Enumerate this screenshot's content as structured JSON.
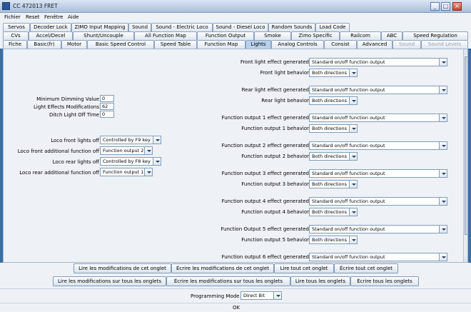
{
  "window": {
    "title": "CC 472013 FRET"
  },
  "menu": [
    "Fichier",
    "Reset",
    "Fenêtre",
    "Aide"
  ],
  "tabs": {
    "row1": [
      "Servos",
      "Decoder Lock",
      "ZIMO Input Mapping",
      "Sound",
      "Sound - Electric Loco",
      "Sound - Diesel Loco",
      "Random Sounds",
      "Load Code"
    ],
    "row2": [
      "CVs",
      "Accel/Decel",
      "Shunt/Uncouple",
      "All Function Map",
      "Function Output",
      "Smoke",
      "Zimo Specific",
      "Railcom",
      "ABC",
      "Speed Regulation"
    ],
    "row3": [
      "Fiche",
      "Basic(fr)",
      "Motor",
      "Basic Speed Control",
      "Speed Table",
      "Function Map",
      "Lights",
      "Analog Controls",
      "Consist",
      "Advanced",
      "Sound",
      "Sound Levels"
    ]
  },
  "left": {
    "dimming_label": "Minimum Dimming Value",
    "dimming_value": "0",
    "effects_label": "Light Effects Modifications",
    "effects_value": "62",
    "ditch_label": "Ditch Light Off Time",
    "ditch_value": "0",
    "loco_front_off_label": "Loco front lights off",
    "loco_front_off_value": "Controlled by F9 key",
    "loco_front_add_label": "Loco front additional function off",
    "loco_front_add_value": "Function output 2",
    "loco_rear_off_label": "Loco rear lights off",
    "loco_rear_off_value": "Controlled by F8 key",
    "loco_rear_add_label": "Loco rear additional function off",
    "loco_rear_add_value": "Function output 1"
  },
  "right": [
    {
      "effect_label": "Front light effect generated",
      "effect_value": "Standard on/off function output",
      "behavior_label": "Front light behavior",
      "behavior_value": "Both directions"
    },
    {
      "effect_label": "Rear light effect generated",
      "effect_value": "Standard on/off function output",
      "behavior_label": "Rear light behavior",
      "behavior_value": "Both directions"
    },
    {
      "effect_label": "Function output 1 effect generated",
      "effect_value": "Standard on/off function output",
      "behavior_label": "Function output 1 behavior",
      "behavior_value": "Both directions"
    },
    {
      "effect_label": "Function output 2 effect generated",
      "effect_value": "Standard on/off function output",
      "behavior_label": "Function output 2 behavior",
      "behavior_value": "Both directions"
    },
    {
      "effect_label": "Function output 3 effect generated",
      "effect_value": "Standard on/off function output",
      "behavior_label": "Function output 3 behavior",
      "behavior_value": "Both directions"
    },
    {
      "effect_label": "Function output 4 effect generated",
      "effect_value": "Standard on/off function output",
      "behavior_label": "Function output 4 behavior",
      "behavior_value": "Both directions"
    },
    {
      "effect_label": "Function Output 5 effect generated",
      "effect_value": "Standard on/off function output",
      "behavior_label": "Function output 5 behavior",
      "behavior_value": "Both directions"
    },
    {
      "effect_label": "Function output 6 effect generated",
      "effect_value": "Standard on/off function output",
      "behavior_label": "",
      "behavior_value": ""
    }
  ],
  "buttons": {
    "read_tab": "Lire les modifications de cet onglet",
    "write_tab": "Écrire les modifications de cet onglet",
    "read_all_tab": "Lire tout cet onglet",
    "write_all_tab": "Écrire tout cet onglet",
    "read_all_mods": "Lire les modifications sur tous les onglets",
    "write_all_mods": "Écrire les modifications sur tous les onglets",
    "read_all": "Lire tous les onglets",
    "write_all": "Écrire tous les onglets"
  },
  "programming": {
    "label": "Programming Mode",
    "value": "Direct Bit"
  },
  "status": "OK"
}
